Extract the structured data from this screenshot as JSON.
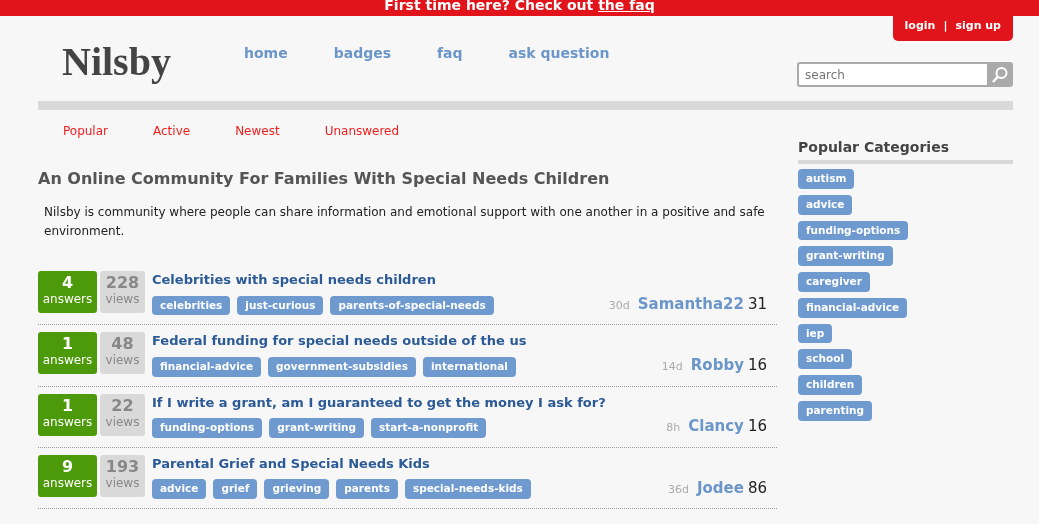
{
  "banner": {
    "text": "First time here? Check out ",
    "link": "the faq"
  },
  "account": {
    "login": "login",
    "separator": "|",
    "signup": "sign up"
  },
  "logo": "Nilsby",
  "nav": [
    "home",
    "badges",
    "faq",
    "ask question"
  ],
  "search": {
    "placeholder": "search"
  },
  "sort_tabs": [
    "Popular",
    "Active",
    "Newest",
    "Unanswered"
  ],
  "heading": "An Online Community For Families With Special Needs Children",
  "intro": "Nilsby is community where people can share information and emotional support with one another in a positive and safe environment.",
  "questions": [
    {
      "answers": "4",
      "answers_label": "answers",
      "views": "228",
      "views_label": "views",
      "title": "Celebrities with special needs children",
      "tags": [
        "celebrities",
        "just-curious",
        "parents-of-special-needs"
      ],
      "age": "30d",
      "user": "Samantha22",
      "reputation": "31"
    },
    {
      "answers": "1",
      "answers_label": "answers",
      "views": "48",
      "views_label": "views",
      "title": "Federal funding for special needs outside of the us",
      "tags": [
        "financial-advice",
        "government-subsidies",
        "international"
      ],
      "age": "14d",
      "user": "Robby",
      "reputation": "16"
    },
    {
      "answers": "1",
      "answers_label": "answers",
      "views": "22",
      "views_label": "views",
      "title": "If I write a grant, am I guaranteed to get the money I ask for?",
      "tags": [
        "funding-options",
        "grant-writing",
        "start-a-nonprofit"
      ],
      "age": "8h",
      "user": "Clancy",
      "reputation": "16"
    },
    {
      "answers": "9",
      "answers_label": "answers",
      "views": "193",
      "views_label": "views",
      "title": "Parental Grief and Special Needs Kids",
      "tags": [
        "advice",
        "grief",
        "grieving",
        "parents",
        "special-needs-kids"
      ],
      "age": "36d",
      "user": "Jodee",
      "reputation": "86"
    }
  ],
  "sidebar": {
    "title": "Popular Categories",
    "categories": [
      "autism",
      "advice",
      "funding-options",
      "grant-writing",
      "caregiver",
      "financial-advice",
      "iep",
      "school",
      "children",
      "parenting"
    ]
  }
}
